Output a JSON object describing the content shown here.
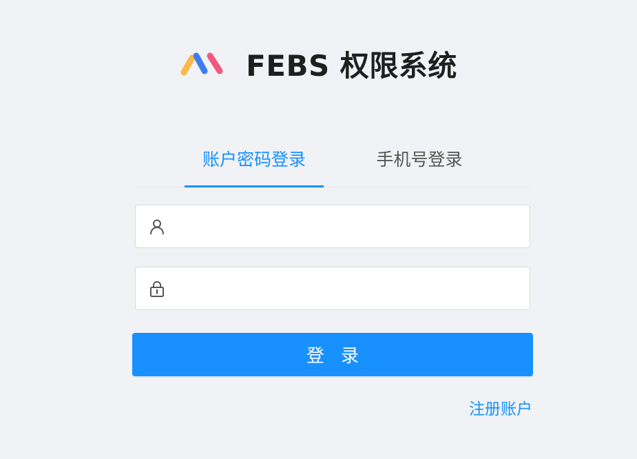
{
  "app": {
    "title": "FEBS 权限系统",
    "logo_icon": "febs-logo-icon"
  },
  "tabs": [
    {
      "label": "账户密码登录",
      "active": true
    },
    {
      "label": "手机号登录",
      "active": false
    }
  ],
  "form": {
    "username": {
      "value": "",
      "placeholder": "",
      "icon": "user-icon"
    },
    "password": {
      "value": "",
      "placeholder": "",
      "icon": "lock-icon"
    },
    "login_label": "登 录",
    "register_label": "注册账户"
  },
  "colors": {
    "primary": "#1890ff",
    "background": "#f0f2f5",
    "logo_orange": "#f9b84a",
    "logo_blue": "#3f7bf0",
    "logo_pink": "#f2587d"
  }
}
